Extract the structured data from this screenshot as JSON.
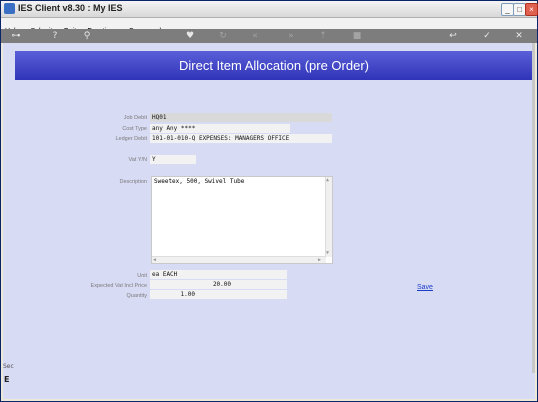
{
  "window": {
    "title": "IES Client v8.30 : My IES"
  },
  "menu": {
    "items": [
      "Help",
      "Submit",
      "Quit",
      "Functions",
      "Commands"
    ]
  },
  "toolbar": {
    "icons": [
      "key-icon",
      "help-icon",
      "search-icon",
      "heart-icon",
      "refresh-icon",
      "rewind-icon",
      "forward-icon",
      "upload-icon",
      "stop-icon",
      "back-icon",
      "ok-icon",
      "close-icon"
    ]
  },
  "page": {
    "heading": "Direct Item Allocation (pre Order)"
  },
  "form": {
    "job_debit_label": "Job Debit",
    "job_debit_value": "HQ01",
    "cost_type_label": "Cost Type",
    "cost_type_value": "any Any ****",
    "ledger_debit_label": "Ledger Debit",
    "ledger_debit_value": "101-01-010-Q EXPENSES: MANAGERS OFFICE",
    "vat_label": "Vat Y/N",
    "vat_value": "Y",
    "description_label": "Description",
    "description_value": "Sweetex, 500, Swivel Tube",
    "unit_label": "Unit",
    "unit_value": "ea EACH",
    "price_label": "Expected Vat Incl Price",
    "price_value": "20.00",
    "quantity_label": "Quantity",
    "quantity_value": "1.00",
    "save_label": "Save"
  },
  "sidebar": {
    "marker_text": "Sec"
  }
}
